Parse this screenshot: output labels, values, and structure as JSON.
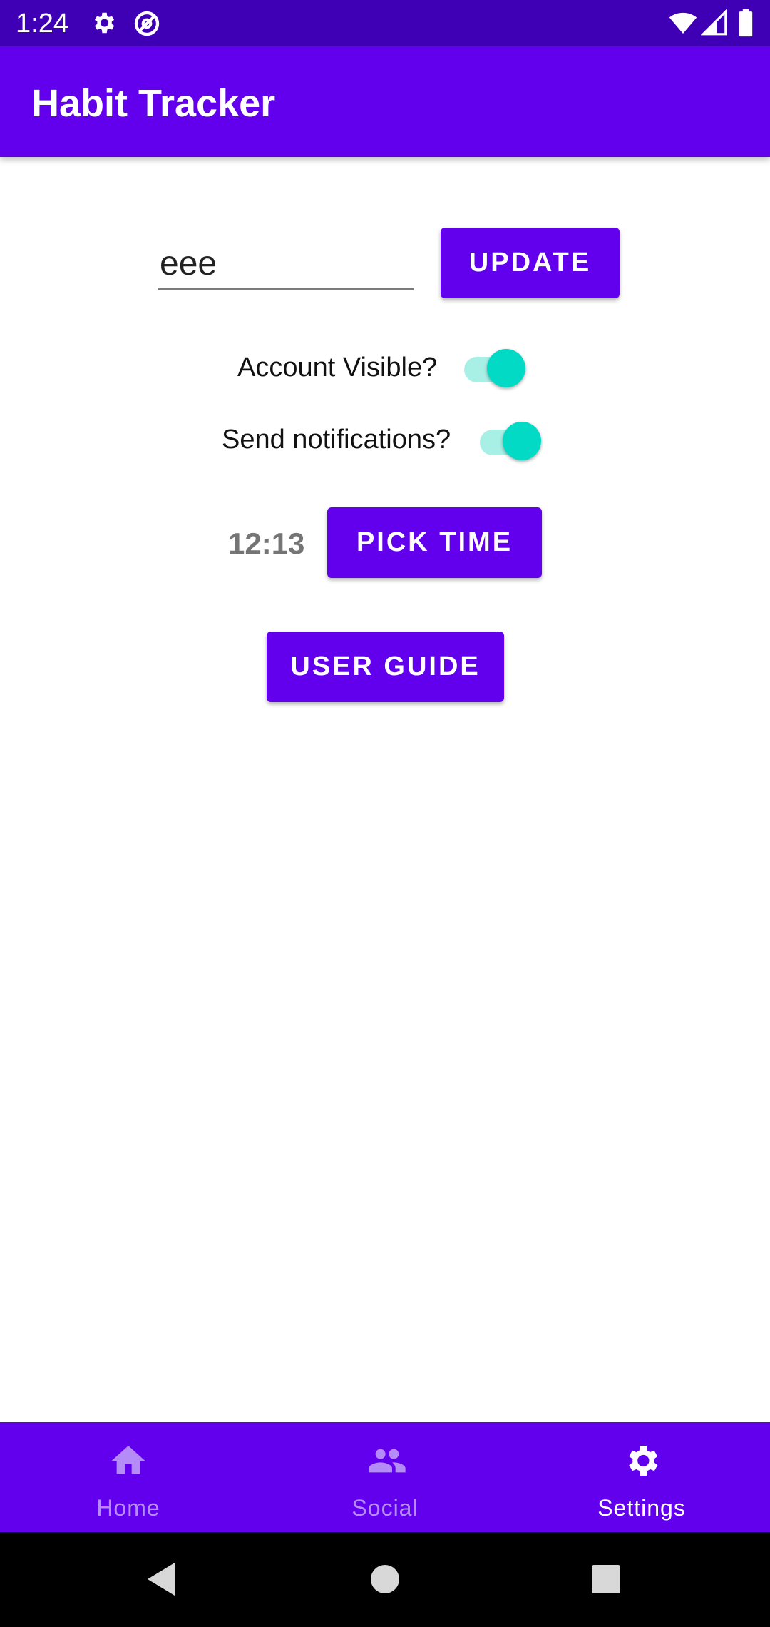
{
  "status_bar": {
    "time": "1:24",
    "left_icons": [
      "gear-icon",
      "at-sign-icon"
    ],
    "right_icons": [
      "wifi-icon",
      "signal-icon",
      "battery-icon"
    ]
  },
  "app_bar": {
    "title": "Habit Tracker"
  },
  "profile": {
    "name_value": "eee",
    "update_label": "UPDATE"
  },
  "settings": {
    "account_visible_label": "Account Visible?",
    "account_visible_on": true,
    "notifications_label": "Send notifications?",
    "notifications_on": true
  },
  "reminder": {
    "time_value": "12:13",
    "pick_time_label": "PICK TIME"
  },
  "user_guide_label": "USER GUIDE",
  "bottom_nav": {
    "items": [
      {
        "label": "Home",
        "icon": "home-icon",
        "active": false
      },
      {
        "label": "Social",
        "icon": "people-icon",
        "active": false
      },
      {
        "label": "Settings",
        "icon": "gear-icon",
        "active": true
      }
    ]
  },
  "system_nav": {
    "icons": [
      "back-icon",
      "home-circle-icon",
      "recents-icon"
    ]
  },
  "colors": {
    "primary": "#6200ee",
    "primary_dark": "#3f00b5",
    "accent": "#03dac5",
    "nav_inactive": "#b58bf8"
  }
}
